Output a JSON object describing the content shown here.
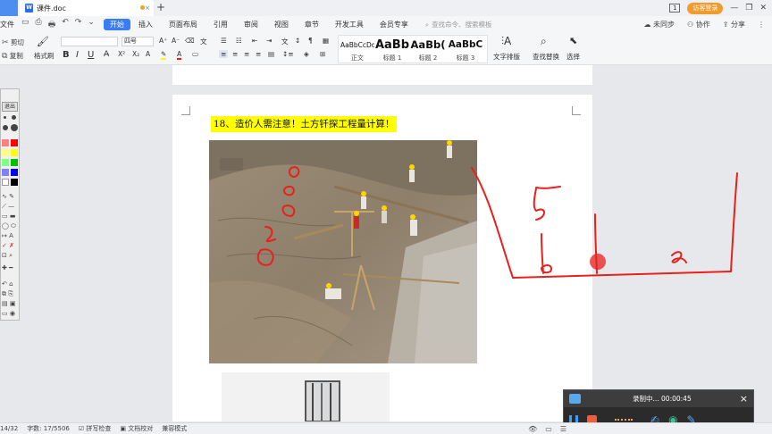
{
  "titlebar": {
    "tab_title": "课件.doc",
    "tab_close": "×",
    "new_tab": "+",
    "window_count": "1",
    "visitor_login": "访客登录",
    "min": "—",
    "max": "❐",
    "close": "✕"
  },
  "menubar": {
    "file": "文件",
    "items": [
      "开始",
      "插入",
      "页面布局",
      "引用",
      "审阅",
      "视图",
      "章节",
      "开发工具",
      "会员专享"
    ],
    "active_index": 0,
    "search": "查找命令、搜索模板",
    "unsynced": "未同步",
    "collaborate": "协作",
    "share": "分享"
  },
  "ribbon": {
    "cut": "剪切",
    "copy": "复制",
    "format_painter": "格式刷",
    "font_size": "四号",
    "styles": [
      {
        "sample": "AaBbCcDd",
        "name": "正文"
      },
      {
        "sample": "AaBb",
        "name": "标题 1"
      },
      {
        "sample": "AaBb(",
        "name": "标题 2"
      },
      {
        "sample": "AaBbC",
        "name": "标题 3"
      }
    ],
    "text_layout": "文字排版",
    "find_replace": "查找替换",
    "select": "选择"
  },
  "palette": {
    "exit": "退出"
  },
  "document": {
    "heading": "18、造价人需注意！土方钎探工程量计算！"
  },
  "recorder": {
    "status": "录制中... 00:00:45",
    "close": "×"
  },
  "statusbar": {
    "page": "14/32",
    "word_count": "字数: 17/5506",
    "spell_check": "拼写检查",
    "doc_proof": "文档校对",
    "compat_mode": "兼容模式"
  },
  "colors": {
    "accent": "#3a7cf1",
    "ink": "#e8211d",
    "highlight": "#ffff00",
    "visitor": "#f19b2c"
  }
}
